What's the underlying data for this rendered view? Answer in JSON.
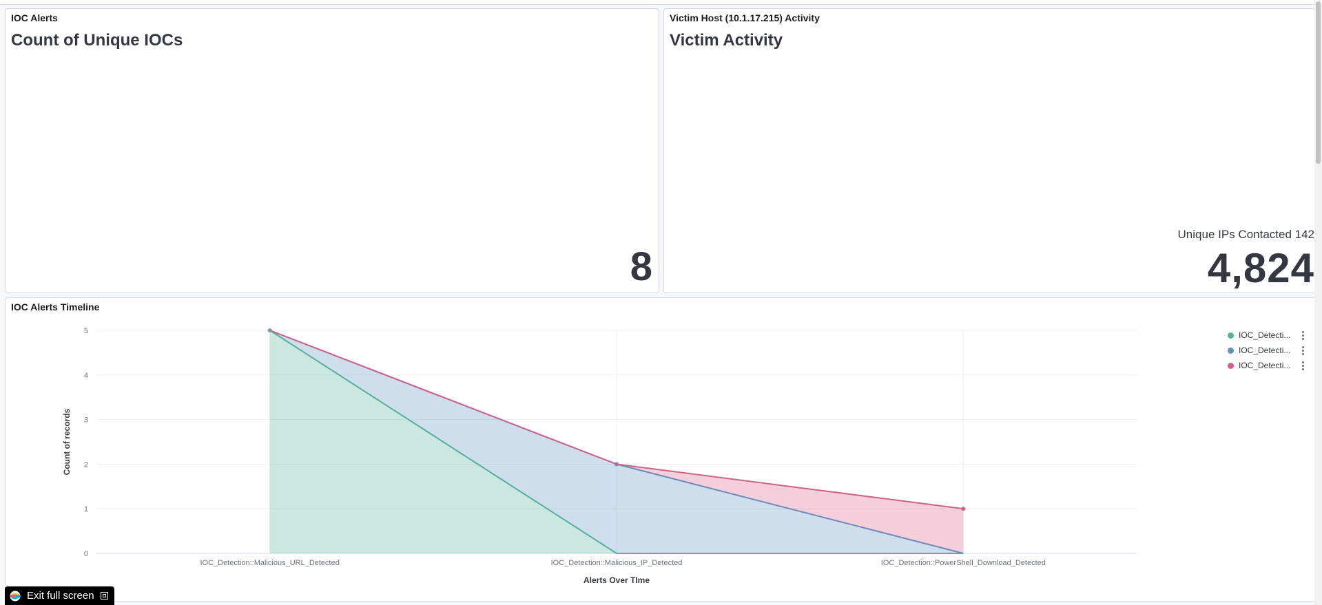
{
  "panels": {
    "ioc_alerts": {
      "title": "IOC Alerts",
      "heading": "Count of Unique IOCs",
      "value": "8"
    },
    "victim_activity": {
      "title": "Victim Host (10.1.17.215) Activity",
      "heading": "Victim Activity",
      "subtitle": "Unique IPs Contacted 142",
      "value": "4,824"
    },
    "timeline": {
      "title": "IOC Alerts Timeline"
    }
  },
  "legend": [
    {
      "label": "IOC_Detecti...",
      "color": "#54b399"
    },
    {
      "label": "IOC_Detecti...",
      "color": "#6092c0"
    },
    {
      "label": "IOC_Detecti...",
      "color": "#d36086"
    }
  ],
  "fullscreen": {
    "exit_label": "Exit full screen"
  },
  "chart_data": {
    "type": "area",
    "stacked": true,
    "categories": [
      "IOC_Detection::Malicious_URL_Detected",
      "IOC_Detection::Malicious_IP_Detected",
      "IOC_Detection::PowerShell_Download_Detected"
    ],
    "series": [
      {
        "values": [
          5,
          0,
          0
        ],
        "color": "#54b399"
      },
      {
        "values": [
          0,
          2,
          0
        ],
        "color": "#6092c0"
      },
      {
        "values": [
          0,
          0,
          1
        ],
        "color": "#d36086"
      }
    ],
    "xlabel": "Alerts Over TIme",
    "ylabel": "Count of records",
    "ylim": [
      0,
      5
    ],
    "yticks": [
      0,
      1,
      2,
      3,
      4,
      5
    ],
    "grid": true,
    "legend_position": "right"
  }
}
